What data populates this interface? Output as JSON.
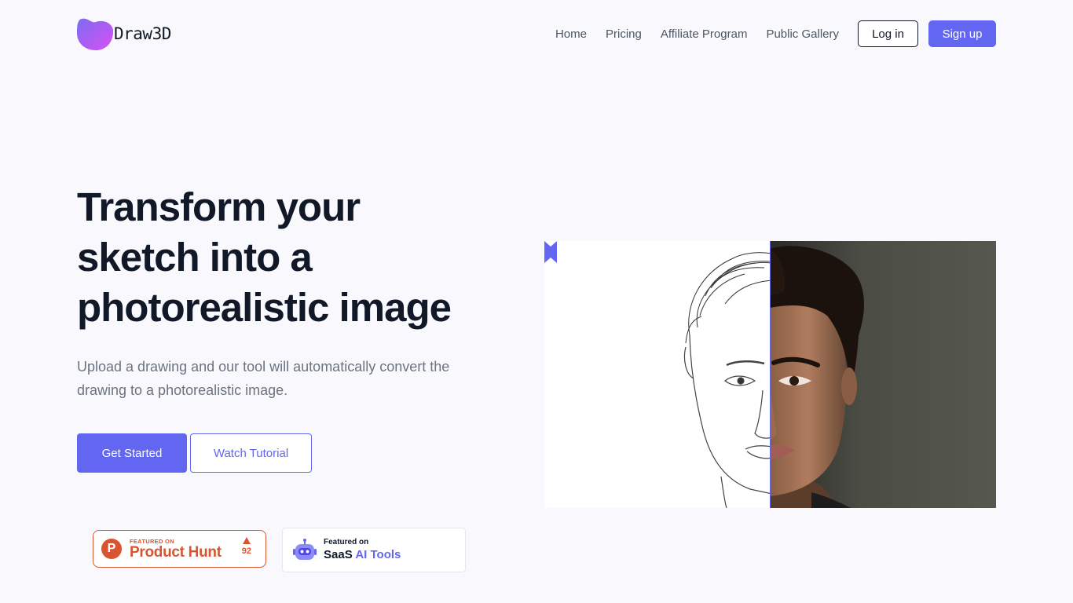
{
  "brand": {
    "name": "Draw3D",
    "accent": "#6366f1"
  },
  "nav": {
    "links": [
      "Home",
      "Pricing",
      "Affiliate Program",
      "Public Gallery"
    ],
    "login_label": "Log in",
    "signup_label": "Sign up"
  },
  "hero": {
    "title_lines": [
      "Transform your",
      "sketch into a",
      "photorealistic image"
    ],
    "subtitle": "Upload a drawing and our tool will automatically convert the drawing to a photorealistic image.",
    "cta_primary": "Get Started",
    "cta_secondary": "Watch Tutorial"
  },
  "badges": {
    "product_hunt": {
      "small": "FEATURED ON",
      "big": "Product Hunt",
      "votes": "92",
      "color": "#da552f"
    },
    "saas_ai_tools": {
      "small": "Featured on",
      "big_prefix": "SaaS",
      "big_accent": "AI Tools"
    }
  },
  "compare": {
    "left_image": "pencil-sketch-of-face",
    "right_image": "photorealistic-face",
    "handle_color": "#6366f1"
  }
}
